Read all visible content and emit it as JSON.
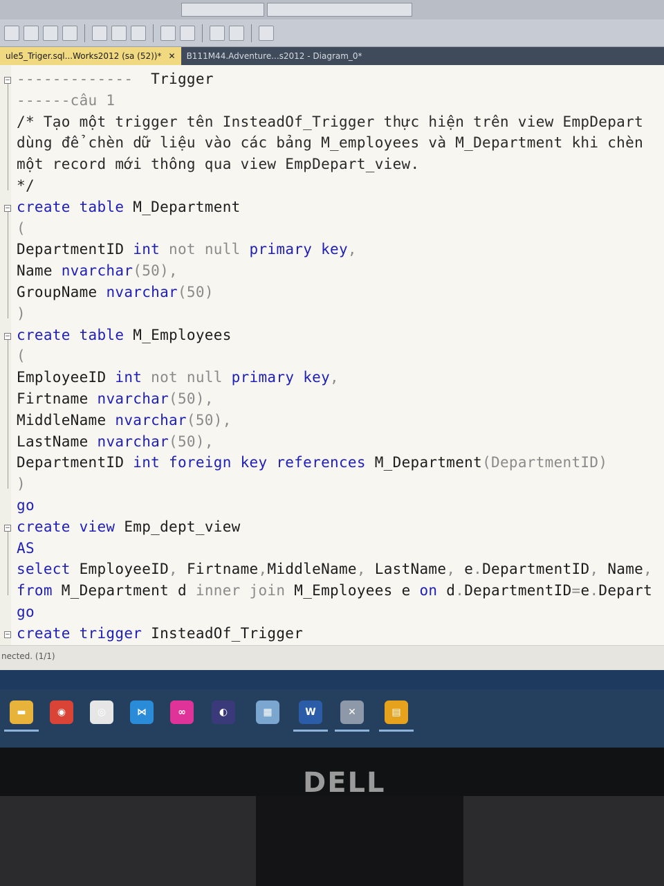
{
  "window": {
    "tabs": [
      {
        "label": "ule5_Triger.sql...Works2012 (sa (52))*",
        "active": true,
        "close": "✕"
      },
      {
        "label": "B111M44.Adventure...s2012 - Diagram_0*",
        "active": false
      }
    ]
  },
  "editor": {
    "lines": [
      {
        "parts": [
          {
            "t": "-------------  ",
            "c": "gr"
          },
          {
            "t": "Trigger",
            "c": "tx"
          }
        ]
      },
      {
        "parts": [
          {
            "t": "------câu 1",
            "c": "gr"
          }
        ]
      },
      {
        "parts": [
          {
            "t": "/* Tạo một trigger tên InsteadOf_Trigger thực hiện trên view EmpDepart",
            "c": "cm"
          }
        ]
      },
      {
        "parts": [
          {
            "t": "dùng để chèn dữ liệu vào các bảng M_employees và M_Department khi chèn",
            "c": "cm"
          }
        ]
      },
      {
        "parts": [
          {
            "t": "một record mới thông qua view EmpDepart_view.",
            "c": "cm"
          }
        ]
      },
      {
        "parts": [
          {
            "t": "*/",
            "c": "cm"
          }
        ]
      },
      {
        "parts": [
          {
            "t": "create table ",
            "c": "kw"
          },
          {
            "t": "M_Department",
            "c": "tx"
          }
        ]
      },
      {
        "parts": [
          {
            "t": "(",
            "c": "gr"
          }
        ]
      },
      {
        "parts": [
          {
            "t": "DepartmentID ",
            "c": "tx"
          },
          {
            "t": "int ",
            "c": "kw"
          },
          {
            "t": "not null ",
            "c": "gr"
          },
          {
            "t": "primary key",
            "c": "kw"
          },
          {
            "t": ",",
            "c": "gr"
          }
        ]
      },
      {
        "parts": [
          {
            "t": "Name ",
            "c": "tx"
          },
          {
            "t": "nvarchar",
            "c": "kw"
          },
          {
            "t": "(50),",
            "c": "gr"
          }
        ]
      },
      {
        "parts": [
          {
            "t": "GroupName ",
            "c": "tx"
          },
          {
            "t": "nvarchar",
            "c": "kw"
          },
          {
            "t": "(50)",
            "c": "gr"
          }
        ]
      },
      {
        "parts": [
          {
            "t": ")",
            "c": "gr"
          }
        ]
      },
      {
        "parts": [
          {
            "t": "create table ",
            "c": "kw"
          },
          {
            "t": "M_Employees",
            "c": "tx"
          }
        ]
      },
      {
        "parts": [
          {
            "t": "(",
            "c": "gr"
          }
        ]
      },
      {
        "parts": [
          {
            "t": "EmployeeID ",
            "c": "tx"
          },
          {
            "t": "int ",
            "c": "kw"
          },
          {
            "t": "not null ",
            "c": "gr"
          },
          {
            "t": "primary key",
            "c": "kw"
          },
          {
            "t": ",",
            "c": "gr"
          }
        ]
      },
      {
        "parts": [
          {
            "t": "Firtname ",
            "c": "tx"
          },
          {
            "t": "nvarchar",
            "c": "kw"
          },
          {
            "t": "(50),",
            "c": "gr"
          }
        ]
      },
      {
        "parts": [
          {
            "t": "MiddleName ",
            "c": "tx"
          },
          {
            "t": "nvarchar",
            "c": "kw"
          },
          {
            "t": "(50),",
            "c": "gr"
          }
        ]
      },
      {
        "parts": [
          {
            "t": "LastName ",
            "c": "tx"
          },
          {
            "t": "nvarchar",
            "c": "kw"
          },
          {
            "t": "(50),",
            "c": "gr"
          }
        ]
      },
      {
        "parts": [
          {
            "t": "DepartmentID ",
            "c": "tx"
          },
          {
            "t": "int foreign key references ",
            "c": "kw"
          },
          {
            "t": "M_Department",
            "c": "tx"
          },
          {
            "t": "(DepartmentID)",
            "c": "gr"
          }
        ]
      },
      {
        "parts": [
          {
            "t": ")",
            "c": "gr"
          }
        ]
      },
      {
        "parts": [
          {
            "t": "go",
            "c": "kw"
          }
        ]
      },
      {
        "parts": [
          {
            "t": "create view ",
            "c": "kw"
          },
          {
            "t": "Emp_dept_view",
            "c": "tx"
          }
        ]
      },
      {
        "parts": [
          {
            "t": "AS",
            "c": "kw"
          }
        ]
      },
      {
        "parts": [
          {
            "t": "select ",
            "c": "kw"
          },
          {
            "t": "EmployeeID",
            "c": "tx"
          },
          {
            "t": ", ",
            "c": "gr"
          },
          {
            "t": "Firtname",
            "c": "tx"
          },
          {
            "t": ",",
            "c": "gr"
          },
          {
            "t": "MiddleName",
            "c": "tx"
          },
          {
            "t": ", ",
            "c": "gr"
          },
          {
            "t": "LastName",
            "c": "tx"
          },
          {
            "t": ", ",
            "c": "gr"
          },
          {
            "t": "e",
            "c": "tx"
          },
          {
            "t": ".",
            "c": "gr"
          },
          {
            "t": "DepartmentID",
            "c": "tx"
          },
          {
            "t": ", ",
            "c": "gr"
          },
          {
            "t": "Name",
            "c": "tx"
          },
          {
            "t": ",",
            "c": "gr"
          }
        ]
      },
      {
        "parts": [
          {
            "t": "from ",
            "c": "kw"
          },
          {
            "t": "M_Department d ",
            "c": "tx"
          },
          {
            "t": "inner join ",
            "c": "gr"
          },
          {
            "t": "M_Employees e ",
            "c": "tx"
          },
          {
            "t": "on ",
            "c": "kw"
          },
          {
            "t": "d",
            "c": "tx"
          },
          {
            "t": ".",
            "c": "gr"
          },
          {
            "t": "DepartmentID",
            "c": "tx"
          },
          {
            "t": "=",
            "c": "gr"
          },
          {
            "t": "e",
            "c": "tx"
          },
          {
            "t": ".",
            "c": "gr"
          },
          {
            "t": "Depart",
            "c": "tx"
          }
        ]
      },
      {
        "parts": [
          {
            "t": "go",
            "c": "kw"
          }
        ]
      },
      {
        "parts": [
          {
            "t": "create trigger ",
            "c": "kw"
          },
          {
            "t": "InsteadOf_Trigger",
            "c": "tx"
          }
        ]
      }
    ]
  },
  "statusbar": {
    "text": "nected. (1/1)"
  },
  "taskbar": {
    "apps": [
      {
        "name": "file-explorer-icon",
        "color": "#e8b33a"
      },
      {
        "name": "chrome-icon",
        "color": "#d94436"
      },
      {
        "name": "network-app-icon",
        "color": "#e6e6e6"
      },
      {
        "name": "vscode-icon",
        "color": "#2a8bd8"
      },
      {
        "name": "flickr-like-icon",
        "color": "#e0339a"
      },
      {
        "name": "eclipse-icon",
        "color": "#3a3a7a"
      },
      {
        "name": "ssms-icon",
        "color": "#7aa6cf"
      },
      {
        "name": "word-icon",
        "color": "#2b5ca8"
      },
      {
        "name": "tools-icon",
        "color": "#8d99a8"
      },
      {
        "name": "pdf-icon",
        "color": "#e6a21c"
      }
    ]
  },
  "monitor": {
    "brand": "DELL"
  }
}
